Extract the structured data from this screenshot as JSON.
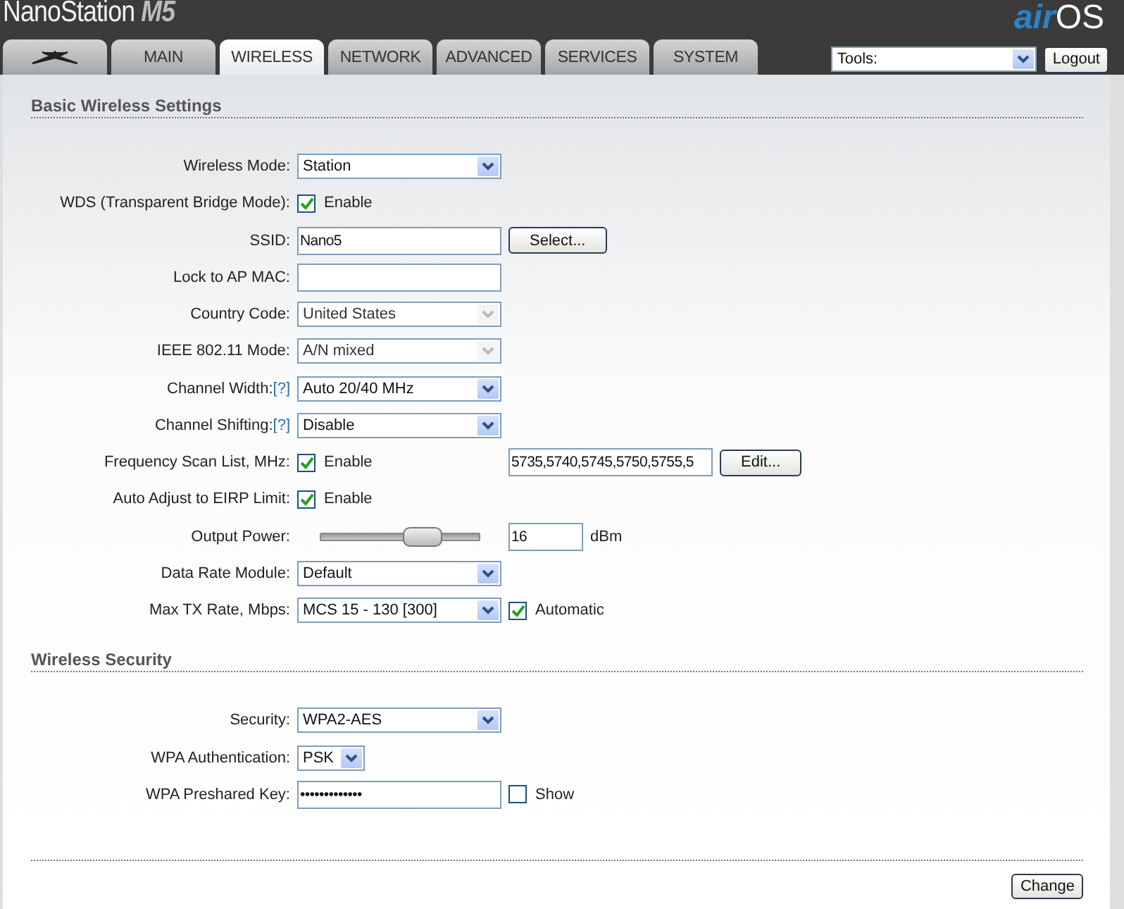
{
  "header": {
    "product": "NanoStation",
    "model": "M5",
    "logo_prefix": "air",
    "logo_suffix": "OS"
  },
  "tabs": [
    {
      "kind": "icon",
      "selected": false
    },
    {
      "kind": "text",
      "label": "MAIN",
      "selected": false
    },
    {
      "kind": "text",
      "label": "WIRELESS",
      "selected": true
    },
    {
      "kind": "text",
      "label": "NETWORK",
      "selected": false
    },
    {
      "kind": "text",
      "label": "ADVANCED",
      "selected": false
    },
    {
      "kind": "text",
      "label": "SERVICES",
      "selected": false
    },
    {
      "kind": "text",
      "label": "SYSTEM",
      "selected": false
    }
  ],
  "tools": {
    "value": "Tools:"
  },
  "logout": "Logout",
  "sections": [
    {
      "title": "Basic Wireless Settings",
      "rows": [
        {
          "label": "Wireless Mode:",
          "controls": [
            {
              "kind": "select",
              "value": "Station",
              "disabled": false
            }
          ]
        },
        {
          "label": "WDS (Transparent Bridge Mode):",
          "controls": [
            {
              "kind": "checkbox",
              "label": "Enable",
              "checked": true
            }
          ]
        },
        {
          "label": "SSID:",
          "controls": [
            {
              "kind": "text",
              "value": "Nano5"
            },
            {
              "kind": "button",
              "label": "Select..."
            }
          ]
        },
        {
          "label": "Lock to AP MAC:",
          "controls": [
            {
              "kind": "text"
            }
          ]
        },
        {
          "label": "Country Code:",
          "controls": [
            {
              "kind": "select",
              "value": "United States",
              "disabled": true
            }
          ]
        },
        {
          "label": "IEEE 802.11 Mode:",
          "controls": [
            {
              "kind": "select",
              "value": "A/N mixed",
              "disabled": true
            }
          ]
        },
        {
          "label": "Channel Width:",
          "help": "[?]",
          "controls": [
            {
              "kind": "select",
              "value": "Auto 20/40 MHz",
              "disabled": false
            }
          ]
        },
        {
          "label": "Channel Shifting:",
          "help": "[?]",
          "controls": [
            {
              "kind": "select",
              "value": "Disable",
              "disabled": false
            }
          ]
        },
        {
          "label": "Frequency Scan List, MHz:",
          "controls": [
            {
              "kind": "checkbox",
              "label": "Enable",
              "checked": true
            },
            {
              "kind": "text",
              "value": "5735,5740,5745,5750,5755,5"
            },
            {
              "kind": "button",
              "label": "Edit..."
            }
          ]
        },
        {
          "label": "Auto Adjust to EIRP Limit:",
          "controls": [
            {
              "kind": "checkbox",
              "label": "Enable",
              "checked": true
            }
          ]
        },
        {
          "label": "Output Power:",
          "controls": [
            {
              "kind": "slider",
              "level": 0.65
            },
            {
              "kind": "short-text",
              "value": "16"
            },
            {
              "kind": "unit",
              "label": "dBm"
            }
          ]
        },
        {
          "label": "Data Rate Module:",
          "controls": [
            {
              "kind": "select",
              "value": "Default",
              "disabled": false
            }
          ]
        },
        {
          "label": "Max TX Rate, Mbps:",
          "controls": [
            {
              "kind": "select",
              "value": "MCS 15 - 130 [300]",
              "disabled": false
            },
            {
              "kind": "checkbox",
              "label": "Automatic",
              "checked": true
            }
          ]
        }
      ]
    },
    {
      "title": "Wireless Security",
      "rows": [
        {
          "label": "Security:",
          "controls": [
            {
              "kind": "select",
              "value": "WPA2-AES",
              "disabled": false
            }
          ]
        },
        {
          "label": "WPA Authentication:",
          "controls": [
            {
              "kind": "short-select",
              "value": "PSK",
              "disabled": false
            }
          ]
        },
        {
          "label": "WPA Preshared Key:",
          "controls": [
            {
              "kind": "text",
              "value": "•••••••••••••"
            },
            {
              "kind": "checkbox",
              "label": "Show",
              "checked": false
            }
          ]
        }
      ]
    }
  ],
  "change_button": "Change"
}
